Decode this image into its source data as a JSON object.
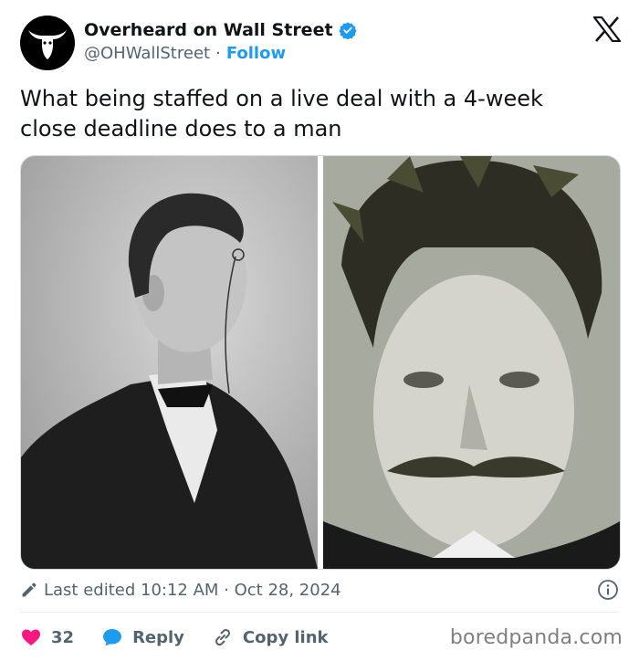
{
  "account": {
    "name": "Overheard on Wall Street",
    "handle": "@OHWallStreet",
    "separator": "·",
    "follow_label": "Follow"
  },
  "tweet": {
    "text": "What being staffed on a live deal with a 4-week close deadline does to a man"
  },
  "meta": {
    "edited_label": "Last edited 10:12 AM · Oct 28, 2024"
  },
  "actions": {
    "like_count": "32",
    "reply_label": "Reply",
    "copy_link_label": "Copy link"
  },
  "watermark": "boredpanda.com",
  "colors": {
    "accent": "#1d9bf0",
    "like": "#f91880",
    "text": "#0f1419",
    "muted": "#536471"
  },
  "icons": [
    "bull-logo-icon",
    "verified-badge-icon",
    "x-logo-icon",
    "pencil-icon",
    "info-icon",
    "heart-icon",
    "reply-bubble-icon",
    "link-icon"
  ]
}
